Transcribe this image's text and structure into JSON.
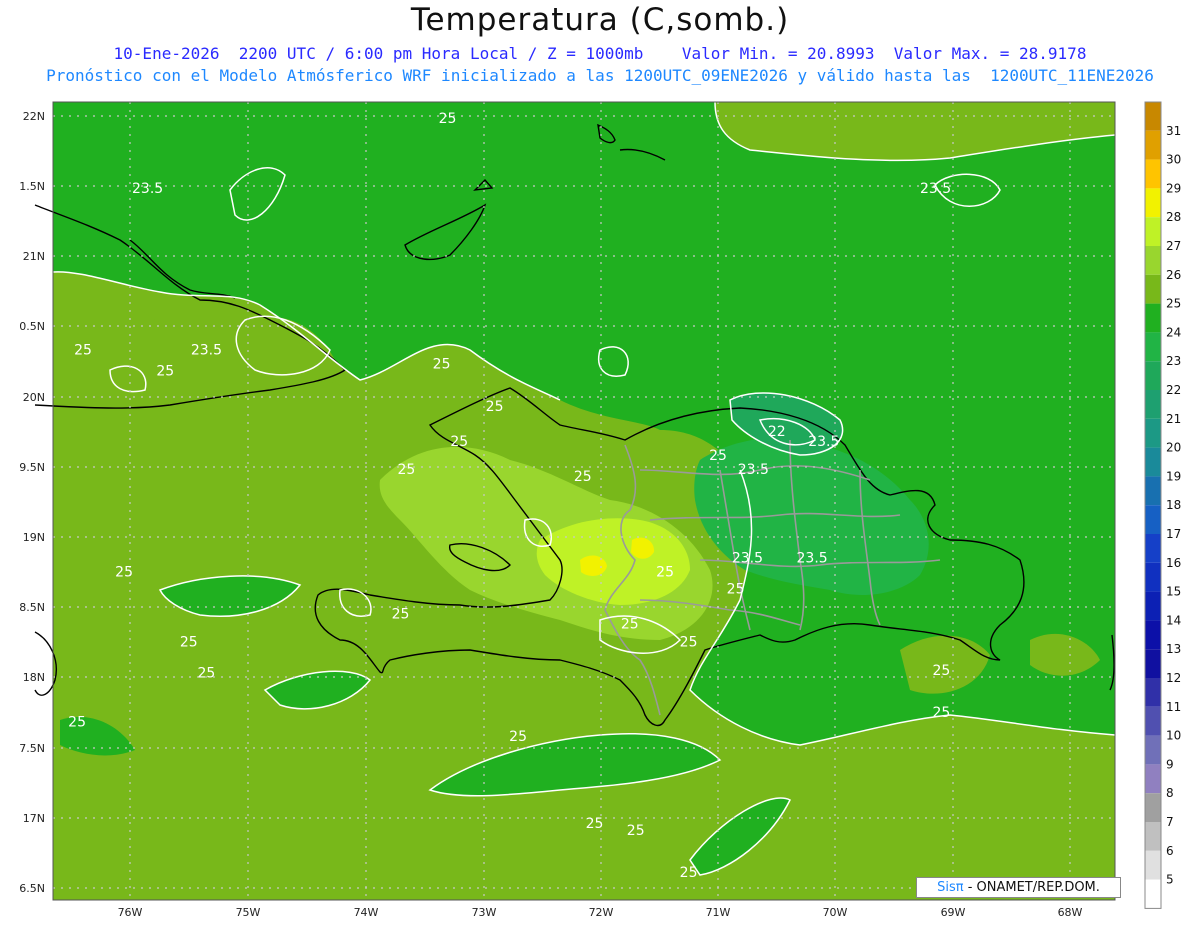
{
  "header": {
    "title": "Temperatura (C,somb.)",
    "line1": "10-Ene-2026  2200 UTC / 6:00 pm Hora Local / Z = 1000mb    Valor Min. = 20.8993  Valor Max. = 28.9178",
    "line2": "Pronóstico con el Modelo Atmósferico WRF inicializado a las 1200UTC_09ENE2026 y válido hasta las  1200UTC_11ENE2026"
  },
  "axes": {
    "lat_labels": [
      "22N",
      "1.5N",
      "21N",
      "0.5N",
      "20N",
      "9.5N",
      "19N",
      "8.5N",
      "18N",
      "7.5N",
      "17N",
      "6.5N"
    ],
    "lon_labels": [
      "76W",
      "75W",
      "74W",
      "73W",
      "72W",
      "71W",
      "70W",
      "69W",
      "68W"
    ],
    "lat_range": [
      16.4,
      22.1
    ],
    "lon_range": [
      -76.65,
      -67.6
    ],
    "grid": true
  },
  "colorbar": {
    "levels": [
      "31",
      "30",
      "29",
      "28",
      "27",
      "26",
      "25",
      "24",
      "23",
      "22",
      "21",
      "20",
      "19",
      "18",
      "17",
      "16",
      "15",
      "14",
      "13",
      "12",
      "11",
      "10",
      "9",
      "8",
      "7",
      "6",
      "5"
    ],
    "colors": [
      "#c88800",
      "#e0a000",
      "#ffc400",
      "#f2f200",
      "#bff226",
      "#99d62e",
      "#78b81a",
      "#20b020",
      "#21b445",
      "#1fa85a",
      "#1ea070",
      "#1c9985",
      "#1a8a9a",
      "#1870b0",
      "#1660c4",
      "#1540c8",
      "#1030c0",
      "#0c20b4",
      "#0c10a8",
      "#1010a0",
      "#3030a8",
      "#5050b0",
      "#7070b8",
      "#9080c0",
      "#a0a0a0",
      "#c0c0c0",
      "#e0e0e0",
      "#ffffff"
    ]
  },
  "contour_labels": [
    {
      "text": "25",
      "lon": -73.3,
      "lat": 21.95
    },
    {
      "text": "23.5",
      "lon": -75.85,
      "lat": 21.45
    },
    {
      "text": "23.5",
      "lon": -69.15,
      "lat": 21.45
    },
    {
      "text": "25",
      "lon": -76.4,
      "lat": 20.3
    },
    {
      "text": "23.5",
      "lon": -75.35,
      "lat": 20.3
    },
    {
      "text": "25",
      "lon": -75.7,
      "lat": 20.15
    },
    {
      "text": "25",
      "lon": -73.35,
      "lat": 20.2
    },
    {
      "text": "25",
      "lon": -73.2,
      "lat": 19.65
    },
    {
      "text": "25",
      "lon": -72.9,
      "lat": 19.9
    },
    {
      "text": "25",
      "lon": -73.65,
      "lat": 19.45
    },
    {
      "text": "22",
      "lon": -70.5,
      "lat": 19.72
    },
    {
      "text": "23.5",
      "lon": -70.1,
      "lat": 19.65
    },
    {
      "text": "25",
      "lon": -71.0,
      "lat": 19.55
    },
    {
      "text": "23.5",
      "lon": -70.7,
      "lat": 19.45
    },
    {
      "text": "25",
      "lon": -72.15,
      "lat": 19.4
    },
    {
      "text": "25",
      "lon": -76.05,
      "lat": 18.72
    },
    {
      "text": "23.5",
      "lon": -70.75,
      "lat": 18.82
    },
    {
      "text": "23.5",
      "lon": -70.2,
      "lat": 18.82
    },
    {
      "text": "25",
      "lon": -71.45,
      "lat": 18.72
    },
    {
      "text": "25",
      "lon": -70.85,
      "lat": 18.6
    },
    {
      "text": "25",
      "lon": -73.7,
      "lat": 18.42
    },
    {
      "text": "25",
      "lon": -71.75,
      "lat": 18.35
    },
    {
      "text": "25",
      "lon": -75.5,
      "lat": 18.22
    },
    {
      "text": "25",
      "lon": -71.25,
      "lat": 18.22
    },
    {
      "text": "25",
      "lon": -75.35,
      "lat": 18.0
    },
    {
      "text": "25",
      "lon": -69.1,
      "lat": 18.02
    },
    {
      "text": "25",
      "lon": -69.1,
      "lat": 17.72
    },
    {
      "text": "25",
      "lon": -76.45,
      "lat": 17.65
    },
    {
      "text": "25",
      "lon": -72.7,
      "lat": 17.55
    },
    {
      "text": "25",
      "lon": -72.05,
      "lat": 16.93
    },
    {
      "text": "25",
      "lon": -71.7,
      "lat": 16.88
    },
    {
      "text": "25",
      "lon": -71.25,
      "lat": 16.58
    }
  ],
  "credit": {
    "brand": "Sisπ",
    "text": " - ONAMET/REP.DOM."
  }
}
